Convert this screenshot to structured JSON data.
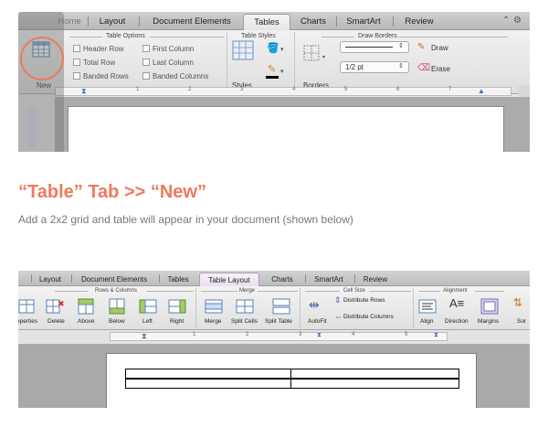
{
  "top_screenshot": {
    "tabs": [
      "Home",
      "Layout",
      "Document Elements",
      "Tables",
      "Charts",
      "SmartArt",
      "Review"
    ],
    "active_tab": "Tables",
    "groups": {
      "table_options": "Table Options",
      "table_styles": "Table Styles",
      "draw_borders": "Draw Borders"
    },
    "new_label": "New",
    "options": {
      "header_row": "Header Row",
      "total_row": "Total Row",
      "banded_rows": "Banded Rows",
      "first_column": "First Column",
      "last_column": "Last Column",
      "banded_columns": "Banded Columns"
    },
    "styles_label": "Styles",
    "borders_label": "Borders",
    "line_weight": "1/2 pt",
    "draw_label": "Draw",
    "erase_label": "Erase",
    "ruler_numbers": [
      "1",
      "2",
      "3",
      "4",
      "5",
      "6",
      "7"
    ]
  },
  "caption": {
    "title": "“Table” Tab >> “New”",
    "text": "Add a 2x2 grid and table will appear in your document (shown below)"
  },
  "bottom_screenshot": {
    "tabs": [
      "Layout",
      "Document Elements",
      "Tables",
      "Table Layout",
      "Charts",
      "SmartArt",
      "Review"
    ],
    "active_tab": "Table Layout",
    "groups": {
      "rows_columns": "Rows & Columns",
      "merge": "Merge",
      "cell_size": "Cell Size",
      "alignment": "Alignment"
    },
    "buttons": {
      "properties": "operties",
      "delete": "Delete",
      "above": "Above",
      "below": "Below",
      "left": "Left",
      "right": "Right",
      "merge": "Merge",
      "split_cells": "Split Cells",
      "split_table": "Split Table",
      "autofit": "AutoFit",
      "distribute_rows": "Distribute Rows",
      "distribute_columns": "Distribute Columns",
      "align": "Align",
      "direction": "Direction",
      "margins": "Margins",
      "sort": "Sor"
    },
    "ruler_numbers": [
      "1",
      "2",
      "3",
      "4",
      "5"
    ]
  },
  "colors": {
    "accent": "#ec7b5d",
    "caption_text": "#777777",
    "active_tab_bottom": "#eadff0"
  }
}
